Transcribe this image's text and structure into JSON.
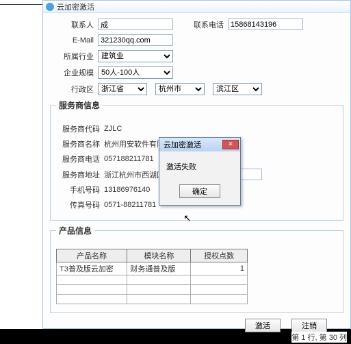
{
  "window": {
    "title": "云加密激活"
  },
  "form": {
    "contact_lbl": "联系人",
    "contact_val": "成",
    "phone_lbl": "联系电话",
    "phone_val": "15868143196",
    "email_lbl": "E-Mail",
    "email_val": "321230qq.com",
    "industry_lbl": "所属行业",
    "industry_val": "建筑业",
    "scale_lbl": "企业规模",
    "scale_val": "50人-100人",
    "region_lbl": "行政区",
    "province": "浙江省",
    "city": "杭州市",
    "district": "滨江区"
  },
  "provider": {
    "legend": "服务商信息",
    "code_lbl": "服务商代码",
    "code_val": "ZJLC",
    "name_lbl": "服务商名称",
    "name_val": "杭州用安软件有限公司",
    "tel_lbl": "服务商电话",
    "tel_val": "057188211781",
    "addr_lbl": "服务商地址",
    "addr_val": "浙江杭州市西湖区文一西",
    "mobile_lbl": "手机号码",
    "mobile_val": "13186976140",
    "fax_lbl": "传真号码",
    "fax_val": "0571-88211781"
  },
  "product": {
    "legend": "产品信息",
    "cols": [
      "产品名称",
      "模块名称",
      "授权点数"
    ],
    "rows": [
      [
        "T3普及版云加密",
        "财务通普及版",
        "1"
      ]
    ]
  },
  "dialog": {
    "title": "云加密激活",
    "message": "激活失败",
    "ok": "确定"
  },
  "buttons": {
    "activate": "激活",
    "register": "注销"
  },
  "status": "第 1 行, 第 30 列"
}
